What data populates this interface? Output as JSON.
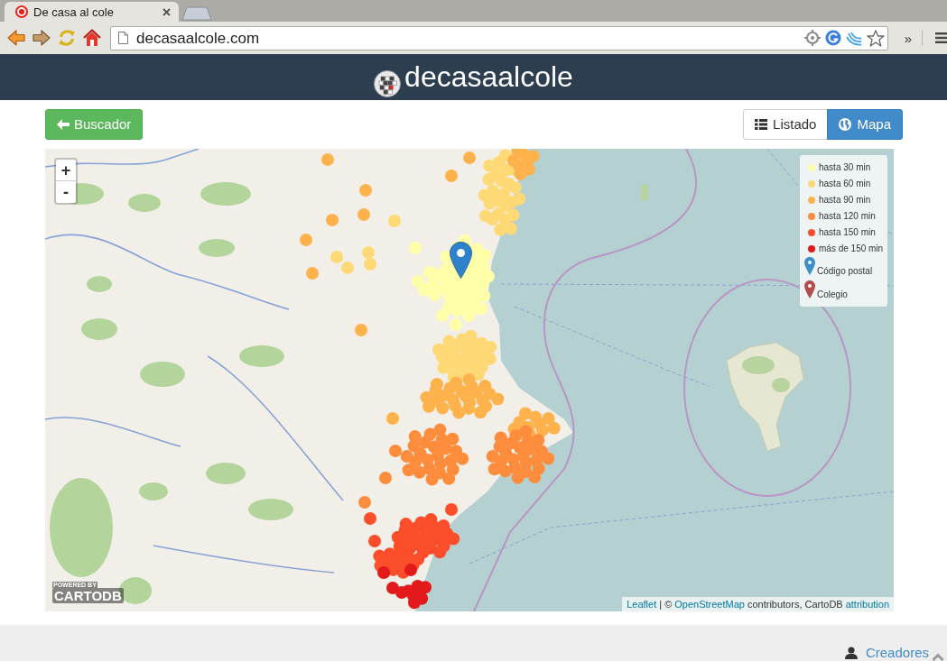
{
  "browser": {
    "tabs": [
      {
        "title": "De casa al cole",
        "selected": true
      }
    ],
    "address": "decasaalcole.com",
    "overflow": "»"
  },
  "header": {
    "brand": "decasaalcole"
  },
  "actions": {
    "back_button": {
      "label": "Buscador"
    },
    "views": [
      {
        "label": "Listado",
        "kind": "list",
        "selected": false
      },
      {
        "label": "Mapa",
        "kind": "map",
        "selected": true
      }
    ]
  },
  "map": {
    "zoom_controls": [
      {
        "kind": "in",
        "label": "+"
      },
      {
        "kind": "out",
        "label": "-"
      }
    ],
    "legend": [
      {
        "label": "hasta 30 min",
        "kind": "dot",
        "color": "#ffffaa"
      },
      {
        "label": "hasta 60 min",
        "kind": "dot",
        "color": "#fed976"
      },
      {
        "label": "hasta 90 min",
        "kind": "dot",
        "color": "#feb24c"
      },
      {
        "label": "hasta 120 min",
        "kind": "dot",
        "color": "#fd8d3c"
      },
      {
        "label": "hasta 150 min",
        "kind": "dot",
        "color": "#fc4e2a"
      },
      {
        "label": "más de 150 min",
        "kind": "dot",
        "color": "#e31a1c"
      },
      {
        "label": "Código postal",
        "kind": "pin",
        "color": "#3d8fc9"
      },
      {
        "label": "Colegio",
        "kind": "pin",
        "color": "#b24f4c"
      }
    ],
    "logo": {
      "caption": "POWERED BY",
      "name": "CARTODB"
    },
    "attribution": [
      {
        "text": "Leaflet",
        "link": true
      },
      {
        "text": "| ©",
        "link": false
      },
      {
        "text": "OpenStreetMap",
        "link": true
      },
      {
        "text": "contributors, CartoDB",
        "link": false
      },
      {
        "text": "attribution",
        "link": true
      }
    ]
  },
  "footer": {
    "link": "Creadores"
  }
}
